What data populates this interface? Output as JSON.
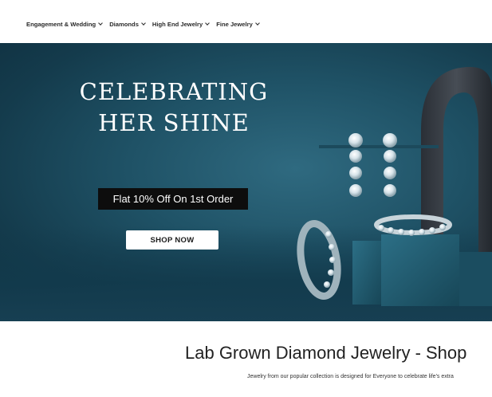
{
  "nav": {
    "items": [
      {
        "label": "Engagement & Wedding"
      },
      {
        "label": "Diamonds"
      },
      {
        "label": "High End Jewelry"
      },
      {
        "label": "Fine Jewelry"
      }
    ]
  },
  "hero": {
    "title_line1": "CELEBRATING",
    "title_line2": "HER SHINE",
    "promo_text": "Flat 10% Off On 1st Order",
    "cta_label": "SHOP NOW"
  },
  "section": {
    "title": "Lab Grown Diamond Jewelry - Shop",
    "description": "Jewelry from our popular collection is designed for Everyone to celebrate life's extra"
  },
  "colors": {
    "hero_bg": "#1f5266",
    "promo_bg": "#0d0d0d",
    "cta_bg": "#ffffff"
  }
}
